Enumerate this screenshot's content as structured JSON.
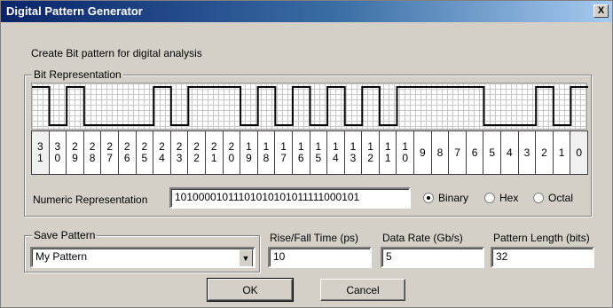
{
  "window": {
    "title": "Digital Pattern Generator",
    "close_glyph": "X"
  },
  "description": "Create Bit pattern for digital analysis",
  "bit_representation": {
    "legend": "Bit Representation",
    "pattern": "10100001011101010101011111000101",
    "bits": [
      {
        "top": "3",
        "bottom": "1"
      },
      {
        "top": "3",
        "bottom": "0"
      },
      {
        "top": "2",
        "bottom": "9"
      },
      {
        "top": "2",
        "bottom": "8"
      },
      {
        "top": "2",
        "bottom": "7"
      },
      {
        "top": "2",
        "bottom": "6"
      },
      {
        "top": "2",
        "bottom": "5"
      },
      {
        "top": "2",
        "bottom": "4"
      },
      {
        "top": "2",
        "bottom": "3"
      },
      {
        "top": "2",
        "bottom": "2"
      },
      {
        "top": "2",
        "bottom": "1"
      },
      {
        "top": "2",
        "bottom": "0"
      },
      {
        "top": "1",
        "bottom": "9"
      },
      {
        "top": "1",
        "bottom": "8"
      },
      {
        "top": "1",
        "bottom": "7"
      },
      {
        "top": "1",
        "bottom": "6"
      },
      {
        "top": "1",
        "bottom": "5"
      },
      {
        "top": "1",
        "bottom": "4"
      },
      {
        "top": "1",
        "bottom": "3"
      },
      {
        "top": "1",
        "bottom": "2"
      },
      {
        "top": "1",
        "bottom": "1"
      },
      {
        "top": "1",
        "bottom": "0"
      },
      {
        "top": "9",
        "bottom": ""
      },
      {
        "top": "8",
        "bottom": ""
      },
      {
        "top": "7",
        "bottom": ""
      },
      {
        "top": "6",
        "bottom": ""
      },
      {
        "top": "5",
        "bottom": ""
      },
      {
        "top": "4",
        "bottom": ""
      },
      {
        "top": "3",
        "bottom": ""
      },
      {
        "top": "2",
        "bottom": ""
      },
      {
        "top": "1",
        "bottom": ""
      },
      {
        "top": "0",
        "bottom": ""
      }
    ]
  },
  "numeric": {
    "label": "Numeric Representation",
    "value": "10100001011101010101011111000101",
    "options": [
      {
        "label": "Binary",
        "selected": true
      },
      {
        "label": "Hex",
        "selected": false
      },
      {
        "label": "Octal",
        "selected": false
      }
    ]
  },
  "save": {
    "legend": "Save Pattern",
    "value": "My Pattern"
  },
  "rise_fall": {
    "label": "Rise/Fall Time (ps)",
    "value": "10"
  },
  "data_rate": {
    "label": "Data Rate (Gb/s)",
    "value": "5"
  },
  "pattern_length": {
    "label": "Pattern Length (bits)",
    "value": "32"
  },
  "buttons": {
    "ok": "OK",
    "cancel": "Cancel"
  }
}
